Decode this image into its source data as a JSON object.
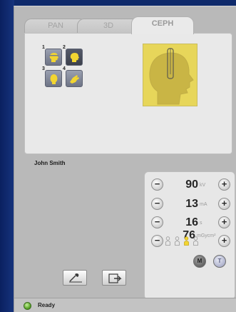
{
  "tabs": [
    {
      "label": "PAN"
    },
    {
      "label": "3D"
    },
    {
      "label": "CEPH"
    }
  ],
  "active_tab": "CEPH",
  "thumbnails": [
    {
      "number": "1",
      "selected": false
    },
    {
      "number": "2",
      "selected": true
    },
    {
      "number": "3",
      "selected": false
    },
    {
      "number": "4",
      "selected": false
    }
  ],
  "patient": {
    "name": "John Smith"
  },
  "settings": {
    "kv": {
      "value": "90",
      "unit": "kV"
    },
    "ma": {
      "value": "13",
      "unit": "mA"
    },
    "time": {
      "value": "16",
      "unit": "s"
    },
    "dose": {
      "value": "76",
      "unit": "mGycm²"
    },
    "minus_symbol": "−",
    "plus_symbol": "+",
    "mode_buttons": [
      {
        "label": "M",
        "active": true
      },
      {
        "label": "T",
        "active": false
      }
    ]
  },
  "status": {
    "text": "Ready"
  },
  "colors": {
    "preview_fill": "#e7d65a",
    "thumb_head": "#f2d531",
    "selected_patient": "#f2d531"
  },
  "icons": [
    "tool-icon",
    "export-icon",
    "status-led-icon"
  ]
}
